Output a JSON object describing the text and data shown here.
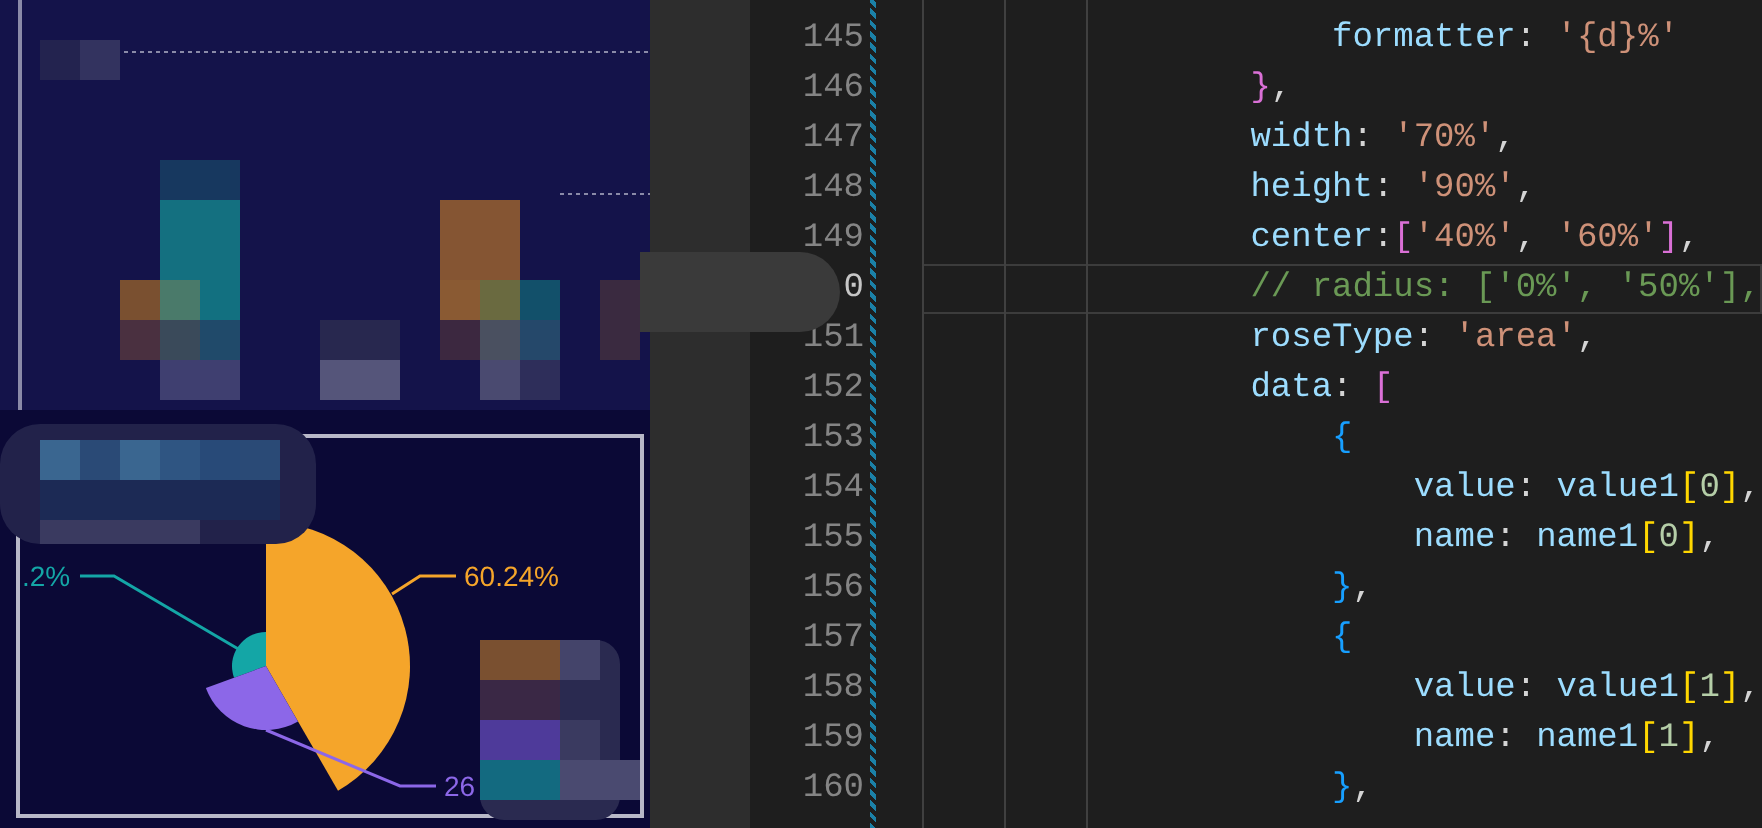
{
  "chart_panel": {
    "labels": [
      {
        "text": ".2%",
        "color": "#14a6a6"
      },
      {
        "text": "60.24%",
        "color": "#f5a52a"
      },
      {
        "text": "26",
        "color": "#8c67e8"
      }
    ]
  },
  "editor": {
    "lines": [
      {
        "number": "145",
        "current": false,
        "tokens": [
          {
            "kind": "key",
            "text": "                    formatter"
          },
          {
            "kind": "punct",
            "text": ": "
          },
          {
            "kind": "string",
            "text": "'{d}%'"
          }
        ]
      },
      {
        "number": "146",
        "current": false,
        "tokens": [
          {
            "kind": "bracket2",
            "text": "                }"
          },
          {
            "kind": "punct",
            "text": ","
          }
        ]
      },
      {
        "number": "147",
        "current": false,
        "tokens": [
          {
            "kind": "key",
            "text": "                width"
          },
          {
            "kind": "punct",
            "text": ": "
          },
          {
            "kind": "string",
            "text": "'70%'"
          },
          {
            "kind": "punct",
            "text": ","
          }
        ]
      },
      {
        "number": "148",
        "current": false,
        "tokens": [
          {
            "kind": "key",
            "text": "                height"
          },
          {
            "kind": "punct",
            "text": ": "
          },
          {
            "kind": "string",
            "text": "'90%'"
          },
          {
            "kind": "punct",
            "text": ","
          }
        ]
      },
      {
        "number": "149",
        "current": false,
        "tokens": [
          {
            "kind": "key",
            "text": "                center"
          },
          {
            "kind": "punct",
            "text": ":"
          },
          {
            "kind": "bracket2",
            "text": "["
          },
          {
            "kind": "string",
            "text": "'40%'"
          },
          {
            "kind": "punct",
            "text": ", "
          },
          {
            "kind": "string",
            "text": "'60%'"
          },
          {
            "kind": "bracket2",
            "text": "]"
          },
          {
            "kind": "punct",
            "text": ","
          }
        ]
      },
      {
        "number": "0",
        "current": true,
        "tokens": [
          {
            "kind": "comment",
            "text": "                // radius: ['0%', '50%'],"
          }
        ]
      },
      {
        "number": "151",
        "current": false,
        "tokens": [
          {
            "kind": "key",
            "text": "                roseType"
          },
          {
            "kind": "punct",
            "text": ": "
          },
          {
            "kind": "string",
            "text": "'area'"
          },
          {
            "kind": "punct",
            "text": ","
          }
        ]
      },
      {
        "number": "152",
        "current": false,
        "tokens": [
          {
            "kind": "key",
            "text": "                data"
          },
          {
            "kind": "punct",
            "text": ": "
          },
          {
            "kind": "bracket2",
            "text": "["
          }
        ]
      },
      {
        "number": "153",
        "current": false,
        "tokens": [
          {
            "kind": "bracket3",
            "text": "                    {"
          }
        ]
      },
      {
        "number": "154",
        "current": false,
        "tokens": [
          {
            "kind": "key",
            "text": "                        value"
          },
          {
            "kind": "punct",
            "text": ": "
          },
          {
            "kind": "key",
            "text": "value1"
          },
          {
            "kind": "bracket1",
            "text": "["
          },
          {
            "kind": "number",
            "text": "0"
          },
          {
            "kind": "bracket1",
            "text": "]"
          },
          {
            "kind": "punct",
            "text": ","
          }
        ]
      },
      {
        "number": "155",
        "current": false,
        "tokens": [
          {
            "kind": "key",
            "text": "                        name"
          },
          {
            "kind": "punct",
            "text": ": "
          },
          {
            "kind": "key",
            "text": "name1"
          },
          {
            "kind": "bracket1",
            "text": "["
          },
          {
            "kind": "number",
            "text": "0"
          },
          {
            "kind": "bracket1",
            "text": "]"
          },
          {
            "kind": "punct",
            "text": ","
          }
        ]
      },
      {
        "number": "156",
        "current": false,
        "tokens": [
          {
            "kind": "bracket3",
            "text": "                    }"
          },
          {
            "kind": "punct",
            "text": ","
          }
        ]
      },
      {
        "number": "157",
        "current": false,
        "tokens": [
          {
            "kind": "bracket3",
            "text": "                    {"
          }
        ]
      },
      {
        "number": "158",
        "current": false,
        "tokens": [
          {
            "kind": "key",
            "text": "                        value"
          },
          {
            "kind": "punct",
            "text": ": "
          },
          {
            "kind": "key",
            "text": "value1"
          },
          {
            "kind": "bracket1",
            "text": "["
          },
          {
            "kind": "number",
            "text": "1"
          },
          {
            "kind": "bracket1",
            "text": "]"
          },
          {
            "kind": "punct",
            "text": ","
          }
        ]
      },
      {
        "number": "159",
        "current": false,
        "tokens": [
          {
            "kind": "key",
            "text": "                        name"
          },
          {
            "kind": "punct",
            "text": ": "
          },
          {
            "kind": "key",
            "text": "name1"
          },
          {
            "kind": "bracket1",
            "text": "["
          },
          {
            "kind": "number",
            "text": "1"
          },
          {
            "kind": "bracket1",
            "text": "]"
          },
          {
            "kind": "punct",
            "text": ","
          }
        ]
      },
      {
        "number": "160",
        "current": false,
        "tokens": [
          {
            "kind": "bracket3",
            "text": "                    }"
          },
          {
            "kind": "punct",
            "text": ","
          }
        ]
      }
    ]
  }
}
